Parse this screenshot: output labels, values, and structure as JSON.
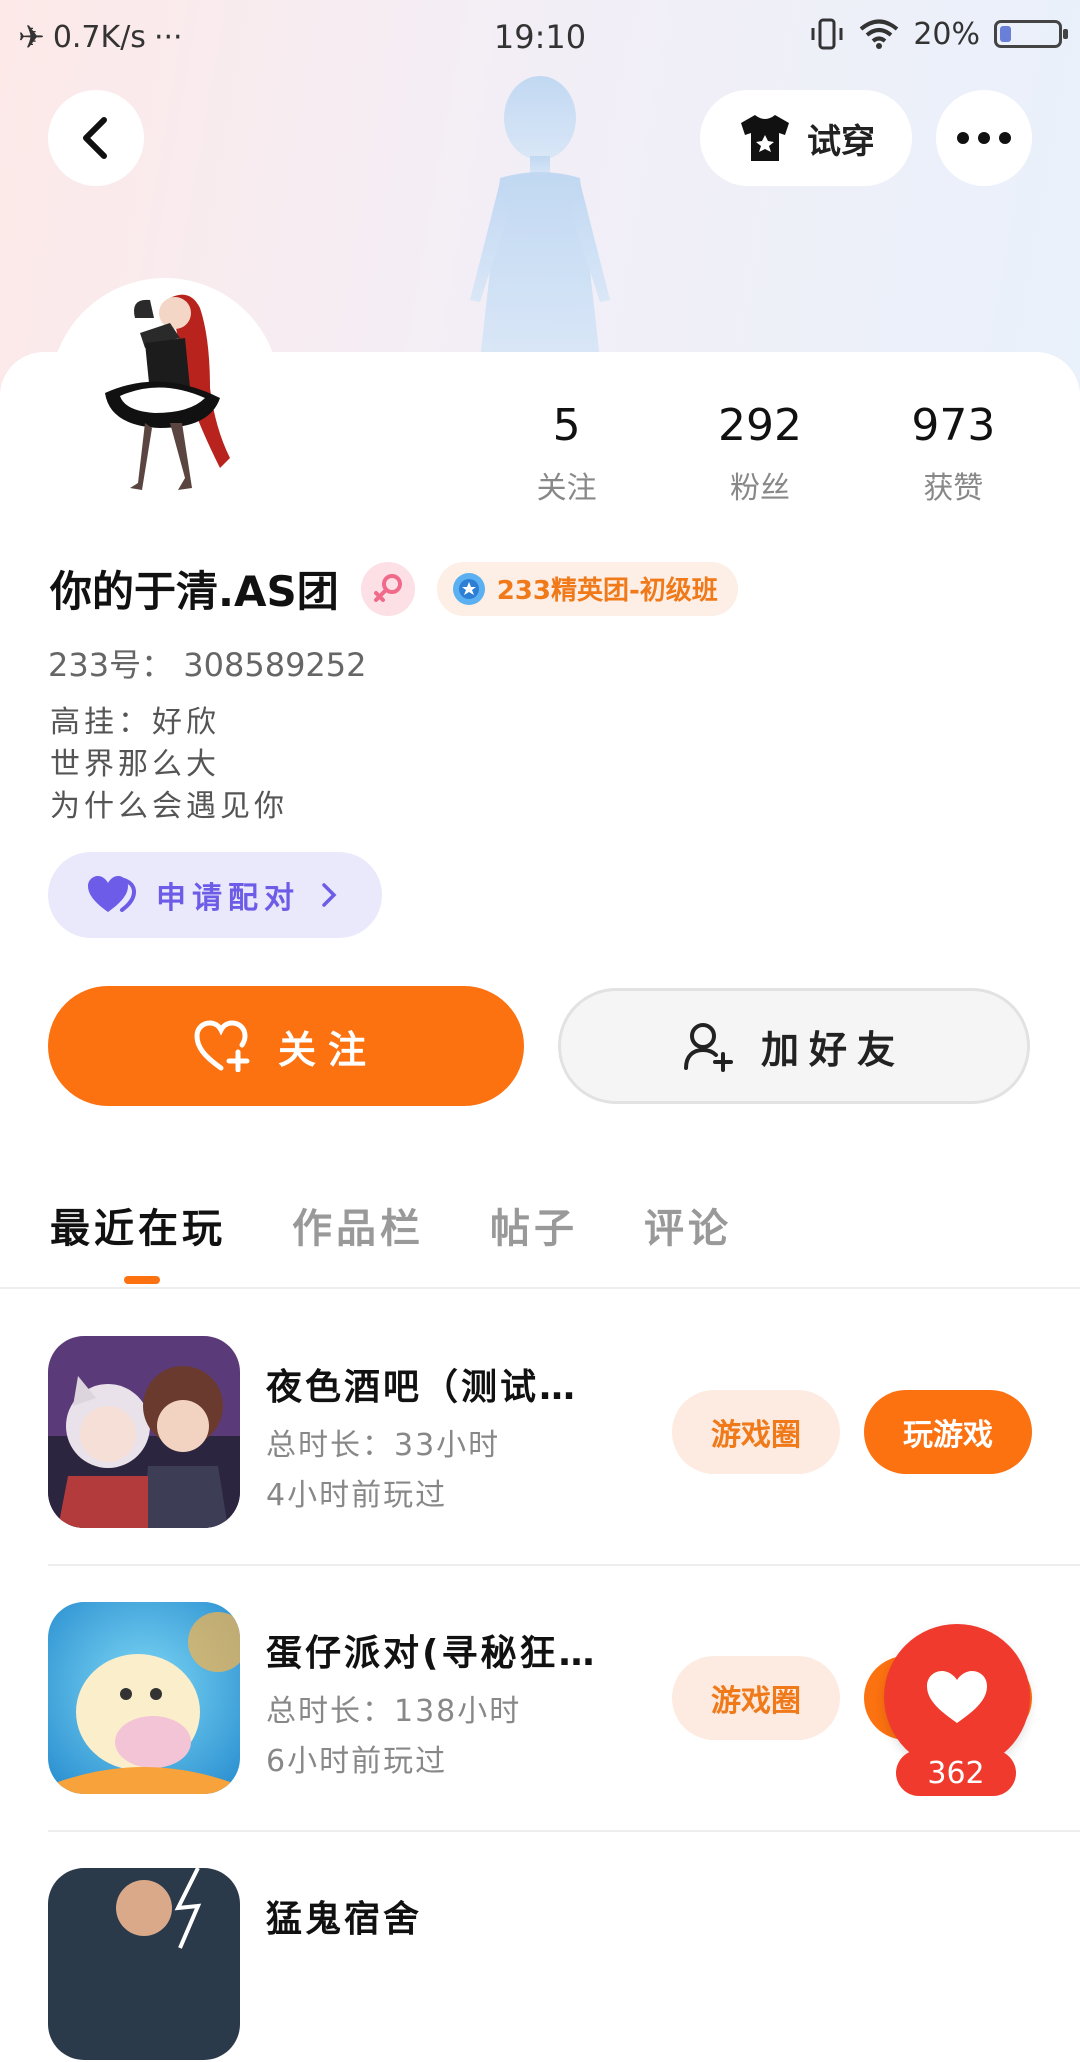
{
  "status_bar": {
    "net_speed": "0.7K/s",
    "more": "···",
    "time": "19:10",
    "battery": "20%",
    "battery_level": 0.2
  },
  "header": {
    "try_on_label": "试穿"
  },
  "stats": [
    {
      "value": "5",
      "label": "关注"
    },
    {
      "value": "292",
      "label": "粉丝"
    },
    {
      "value": "973",
      "label": "获赞"
    }
  ],
  "profile": {
    "nickname": "你的于清.AS团",
    "badge": "233精英团-初级班",
    "uid_label": "233号：",
    "uid": "308589252",
    "bio_lines": [
      "高挂：好欣",
      "世界那么大",
      "为什么会遇见你"
    ],
    "pair_label": "申请配对"
  },
  "actions": {
    "follow": "关注",
    "add_friend": "加好友"
  },
  "tabs": [
    "最近在玩",
    "作品栏",
    "帖子",
    "评论"
  ],
  "games": [
    {
      "title": "夜色酒吧（测试…",
      "duration": "总时长：33小时",
      "last_played": "4小时前玩过",
      "circle": "游戏圈",
      "play": "玩游戏"
    },
    {
      "title": "蛋仔派对(寻秘狂…",
      "duration": "总时长：138小时",
      "last_played": "6小时前玩过",
      "circle": "游戏圈",
      "play": "玩游戏"
    },
    {
      "title": "猛鬼宿舍"
    }
  ],
  "like_count": "362",
  "colors": {
    "accent": "#fc7110",
    "like": "#f03a2e",
    "pair": "#6c5ce7"
  }
}
